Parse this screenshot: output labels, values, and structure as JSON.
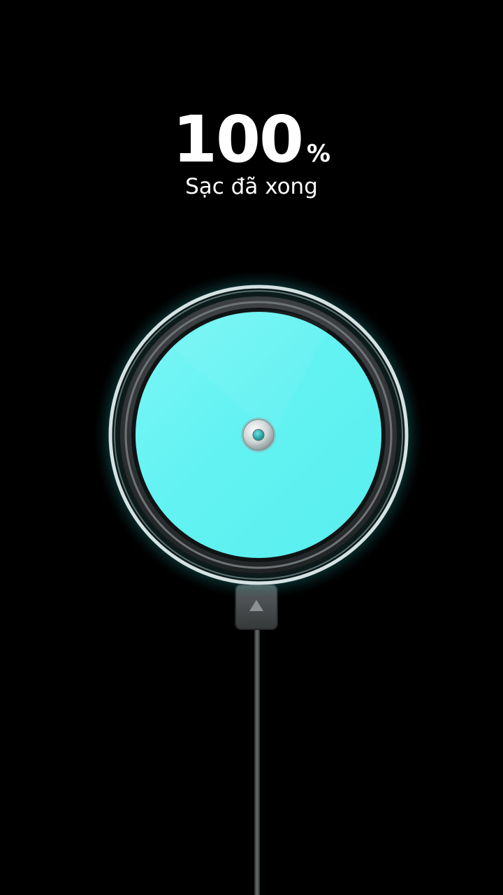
{
  "battery": {
    "level_value": "100",
    "level_unit": "%",
    "level_fraction": 1.0,
    "status": "Sạc đã xong"
  },
  "colors": {
    "background": "#000000",
    "text": "#ffffff",
    "charge_fill": "#5ff4f4",
    "glow": "#4fe6e6",
    "ring": "#d8e4e4"
  },
  "icons": {
    "pad": "wireless-charging-pad-icon",
    "cable": "charging-cable-icon",
    "plug_arrow": "triangle-up-icon"
  }
}
